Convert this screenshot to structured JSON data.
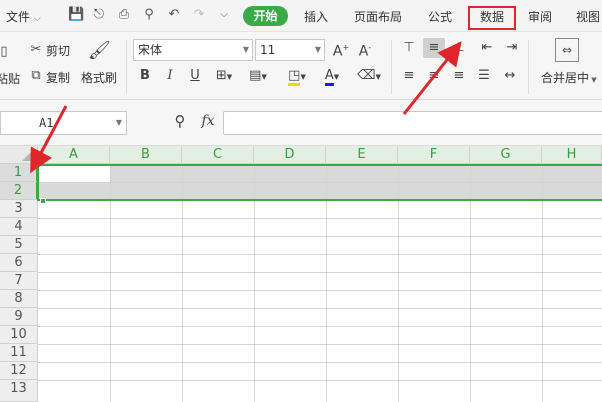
{
  "menu": {
    "file_label": "文件",
    "start_label": "开始",
    "items": [
      "插入",
      "页面布局",
      "公式",
      "数据",
      "审阅",
      "视图"
    ]
  },
  "ribbon": {
    "cut_label": "剪切",
    "paste_label": "粘贴",
    "copy_label": "复制",
    "format_painter_label": "格式刷",
    "font_name": "宋体",
    "font_size": "11",
    "merge_center_label": "合并居中"
  },
  "formula_bar": {
    "cell_ref": "A1",
    "fx_label": "fx",
    "value": ""
  },
  "sheet": {
    "columns": [
      "A",
      "B",
      "C",
      "D",
      "E",
      "F",
      "G",
      "H"
    ],
    "rows": [
      "1",
      "2",
      "3",
      "4",
      "5",
      "6",
      "7",
      "8",
      "9",
      "10",
      "11",
      "12",
      "13"
    ],
    "selected_rows": [
      "1",
      "2"
    ],
    "active_cell": "A1"
  },
  "colors": {
    "accent_green": "#3aaa46",
    "annotation_red": "#e0262a"
  }
}
